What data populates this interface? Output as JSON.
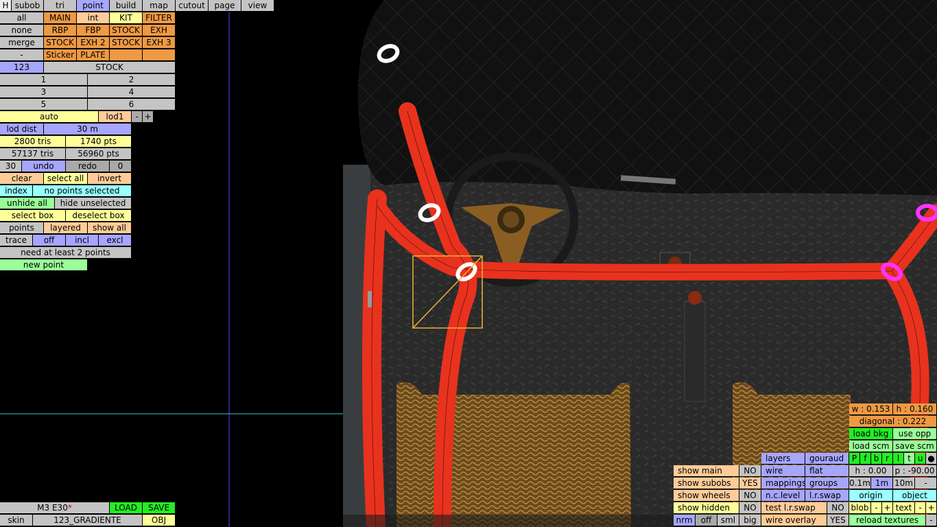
{
  "menu": [
    "H",
    "subob",
    "tri",
    "point",
    "build",
    "map",
    "cutout",
    "page",
    "view"
  ],
  "layers": {
    "rows": [
      [
        "all",
        "MAIN",
        "int",
        "KIT",
        "FILTER"
      ],
      [
        "none",
        "RBP",
        "FBP",
        "STOCK",
        "EXH"
      ],
      [
        "merge",
        "STOCK",
        "EXH 2",
        "STOCK",
        "EXH 3"
      ],
      [
        "-",
        "Sticker",
        "PLATE",
        "",
        ""
      ]
    ],
    "current_num": "123",
    "current_name": "STOCK"
  },
  "nums": [
    "1",
    "2",
    "3",
    "4",
    "5",
    "6"
  ],
  "lod": {
    "auto": "auto",
    "level": "lod1",
    "minus": "-",
    "plus": "+",
    "dist_label": "lod dist",
    "dist_value": "30 m",
    "tris": "2800 tris",
    "pts": "1740 pts",
    "total_tris": "57137 tris",
    "total_pts": "56960 pts"
  },
  "undo": {
    "count": "30",
    "undo": "undo",
    "redo": "redo",
    "redo_count": "0"
  },
  "sel": {
    "clear": "clear",
    "select_all": "select all",
    "invert": "invert",
    "index": "index",
    "status": "no points selected",
    "unhide_all": "unhide all",
    "hide_unselected": "hide unselected",
    "select_box": "select box",
    "deselect_box": "deselect box",
    "points": "points",
    "layered": "layered",
    "show_all": "show all",
    "trace": "trace",
    "off": "off",
    "incl": "incl",
    "excl": "excl",
    "need": "need at least 2 points",
    "new_point": "new point"
  },
  "file": {
    "name": "M3 E30",
    "mark": "*",
    "load": "LOAD",
    "save": "SAVE",
    "skin_label": "skin",
    "skin_value": "123_GRADIENTE",
    "obj": "OBJ"
  },
  "show": {
    "rows": [
      {
        "label": "show main",
        "value": "NO"
      },
      {
        "label": "show subobs",
        "value": "YES"
      },
      {
        "label": "show wheels",
        "value": "NO"
      },
      {
        "label": "show hidden",
        "value": "NO"
      }
    ],
    "nrm": "nrm",
    "off": "off",
    "sml": "sml",
    "big": "big"
  },
  "render": {
    "layers": "layers",
    "gouraud": "gouraud",
    "wire": "wire",
    "flat": "flat",
    "mappings": "mappings",
    "groups": "groups",
    "nclevel": "n.c.level",
    "lrswap": "l.r.swap",
    "test_lrswap": "test l.r.swap",
    "test_lrswap_value": "NO",
    "wire_overlay": "wire overlay",
    "wire_overlay_value": "YES"
  },
  "bkg": {
    "w": "w : 0.153",
    "h": "h : 0.160",
    "diagonal": "diagonal : 0.222",
    "load_bkg": "load bkg",
    "use_opp": "use opp",
    "load_scm": "load scm",
    "save_scm": "save scm",
    "views": [
      "P",
      "f",
      "b",
      "r",
      "l",
      "t",
      "u",
      "●"
    ],
    "hval": "h : 0.00",
    "pval": "p : -90.00",
    "steps": [
      "0.1m",
      "1m",
      "10m",
      "-"
    ],
    "origin": "origin",
    "object": "object",
    "blob": "blob",
    "blob_minus": "-",
    "blob_plus": "+",
    "text": "text",
    "text_minus": "-",
    "text_plus": "+",
    "reload": "reload textures",
    "reload_minus": "-"
  },
  "colors": {
    "orange": "#ee9944",
    "purple": "#a6a6ff",
    "grey": "#c4c4c4",
    "roll_cage": "#e8321e",
    "green": "#22ee22"
  }
}
